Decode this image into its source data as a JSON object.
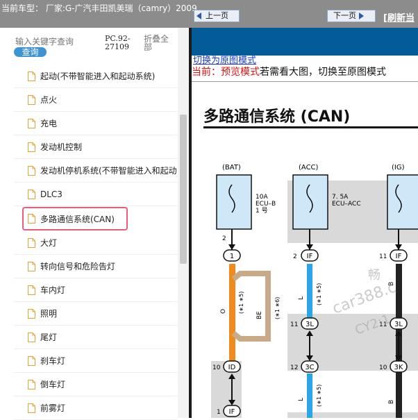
{
  "window": {
    "title": "当前车型：  厂家:G-广汽丰田凯美瑞（camry）2009"
  },
  "sidebar": {
    "search_placeholder": "输入关键字查询",
    "search_button": "查询",
    "pc_code": "PC.92-27109",
    "collapse_all": "折叠全部",
    "items": [
      {
        "label": "起动(不带智能进入和起动系统)"
      },
      {
        "label": "点火"
      },
      {
        "label": "充电"
      },
      {
        "label": "发动机控制"
      },
      {
        "label": "发动机停机系统(不带智能进入和起动系统)"
      },
      {
        "label": "DLC3"
      },
      {
        "label": "多路通信系统(CAN)"
      },
      {
        "label": "大灯"
      },
      {
        "label": "转向信号和危险告灯"
      },
      {
        "label": "车内灯"
      },
      {
        "label": "照明"
      },
      {
        "label": "尾灯"
      },
      {
        "label": "刹车灯"
      },
      {
        "label": "倒车灯"
      },
      {
        "label": "前雾灯"
      }
    ],
    "selected_index": 6
  },
  "toolbar": {
    "prev_label": "上一页",
    "next_label": "下一页",
    "refresh_label": "[刷新当"
  },
  "viewer": {
    "switch_link": "切换为原图模式",
    "mode_label": "当前：预览模式",
    "mode_hint": "若需看大图，切换至原图模式"
  },
  "diagram": {
    "title": "多路通信系统 (CAN)",
    "sources": {
      "bat": "(BAT)",
      "acc": "(ACC)",
      "ig": "(IG)"
    },
    "fuse_bat": [
      "10A",
      "ECU–B",
      "1 号"
    ],
    "fuse_acc": [
      "7. 5A",
      "ECU–ACC"
    ],
    "connectors": {
      "c_2": "2",
      "c_1": "1",
      "c_2if": "2",
      "c_if": "IF",
      "c_11": "11",
      "c_11if": "IF",
      "c_11b": "11",
      "c_3l": "3L",
      "c_11c": "11",
      "c_3l2": "3L",
      "c_10": "10",
      "c_id": "ID",
      "c_12": "12",
      "c_3c": "3C",
      "c_10b": "10",
      "c_3k": "3K",
      "c_1b": "1",
      "c_if2": "IF"
    },
    "wire_labels": {
      "o": "O",
      "be": "BE",
      "l": "L",
      "l2": "L",
      "b": "B",
      "b2": "B",
      "note1": "(∗1 ∗5)",
      "note2": "(∗1 ∗6)",
      "note3": "(∗1 ∗5)",
      "note4": "(∗1 ∗5)"
    },
    "watermark": [
      "畅",
      "car388.c",
      "CY2:1"
    ]
  },
  "colors": {
    "toolbar_bg": "#035b97",
    "topbar_bg": "#8c8c8c",
    "selected_border": "#f05a78",
    "wire_orange": "#f08a1c",
    "wire_blue": "#2aa6e6",
    "wire_tan": "#c8aa88",
    "fuse_box": "#cfe8f7"
  }
}
